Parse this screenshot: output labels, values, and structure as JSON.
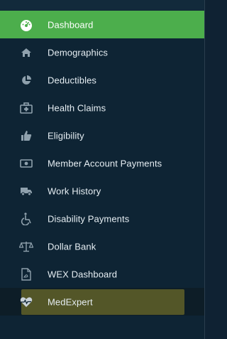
{
  "sidebar": {
    "items": [
      {
        "label": "Dashboard",
        "icon": "dashboard-gauge-icon"
      },
      {
        "label": "Demographics",
        "icon": "home-icon"
      },
      {
        "label": "Deductibles",
        "icon": "pie-chart-icon"
      },
      {
        "label": "Health Claims",
        "icon": "medical-kit-icon"
      },
      {
        "label": "Eligibility",
        "icon": "thumbs-up-icon"
      },
      {
        "label": "Member Account Payments",
        "icon": "money-icon"
      },
      {
        "label": "Work History",
        "icon": "truck-icon"
      },
      {
        "label": "Disability Payments",
        "icon": "wheelchair-icon"
      },
      {
        "label": "Dollar Bank",
        "icon": "balance-scale-icon"
      },
      {
        "label": "WEX Dashboard",
        "icon": "pdf-file-icon"
      },
      {
        "label": "MedExpert",
        "icon": "heartbeat-icon"
      }
    ],
    "active_index": 0,
    "colors": {
      "active": "#4cae4c",
      "background": "#0e2434",
      "hover_highlight": "#6b6a2a"
    }
  }
}
